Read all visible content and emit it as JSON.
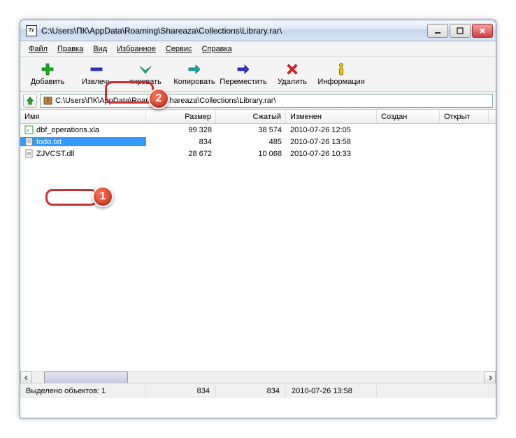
{
  "window": {
    "title": "C:\\Users\\ПК\\AppData\\Roaming\\Shareaza\\Collections\\Library.rar\\",
    "app_badge": "7z"
  },
  "menu": {
    "file": "Файл",
    "edit": "Правка",
    "view": "Вид",
    "favorites": "Избранное",
    "tools": "Сервис",
    "help": "Справка"
  },
  "toolbar": {
    "add": "Добавить",
    "extract": "Извлечь",
    "test_partial": "тировать",
    "copy": "Копировать",
    "move": "Переместить",
    "delete": "Удалить",
    "info": "Информация"
  },
  "address": {
    "path": "C:\\Users\\ПК\\AppData\\Roaming\\Shareaza\\Collections\\Library.rar\\"
  },
  "columns": {
    "name": "Имя",
    "size": "Размер",
    "packed": "Сжатый",
    "modified": "Изменен",
    "created": "Создан",
    "opened": "Открыт"
  },
  "files": [
    {
      "name": "dbf_operations.xla",
      "size": "99 328",
      "packed": "38 574",
      "modified": "2010-07-26 12:05",
      "icon": "excel",
      "selected": false
    },
    {
      "name": "todo.txt",
      "size": "834",
      "packed": "485",
      "modified": "2010-07-26 13:58",
      "icon": "text",
      "selected": true
    },
    {
      "name": "ZJVCST.dll",
      "size": "28 672",
      "packed": "10 068",
      "modified": "2010-07-26 10:33",
      "icon": "dll",
      "selected": false
    }
  ],
  "status": {
    "selected_label": "Выделено объектов: 1",
    "size": "834",
    "packed": "834",
    "modified": "2010-07-26 13:58"
  },
  "annotations": {
    "badge1": "1",
    "badge2": "2"
  }
}
